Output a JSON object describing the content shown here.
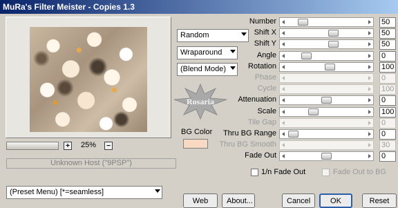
{
  "window": {
    "title": "MuRa's Filter Meister - Copies 1.3"
  },
  "preview": {
    "zoom": "25%",
    "zoom_in_label": "+",
    "zoom_out_label": "−",
    "host_status": "Unknown Host (\"9PSP\")"
  },
  "combos": {
    "mode": "Random",
    "edge": "Wraparound",
    "blend": "(Blend Mode)",
    "preset": "(Preset Menu)  [*=seamless]"
  },
  "logo_text": "Rosaria",
  "bg_color": {
    "label": "BG Color",
    "swatch": "#f8d9c3"
  },
  "params": [
    {
      "label": "Number",
      "value": "50",
      "level": 0.15,
      "enabled": true
    },
    {
      "label": "Shift X",
      "value": "50",
      "level": 0.6,
      "enabled": true
    },
    {
      "label": "Shift Y",
      "value": "50",
      "level": 0.6,
      "enabled": true
    },
    {
      "label": "Angle",
      "value": "0",
      "level": 0.2,
      "enabled": true
    },
    {
      "label": "Rotation",
      "value": "100",
      "level": 0.55,
      "enabled": true
    },
    {
      "label": "Phase",
      "value": "0",
      "level": 0.0,
      "enabled": false
    },
    {
      "label": "Cycle",
      "value": "100",
      "level": 0.0,
      "enabled": false
    },
    {
      "label": "Attenuation",
      "value": "0",
      "level": 0.5,
      "enabled": true
    },
    {
      "label": "Scale",
      "value": "100",
      "level": 0.3,
      "enabled": true
    },
    {
      "label": "Tile Gap",
      "value": "0",
      "level": 0.0,
      "enabled": false
    },
    {
      "label": "Thru BG Range",
      "value": "0",
      "level": 0.0,
      "enabled": true
    },
    {
      "label": "Thru BG Smooth",
      "value": "30",
      "level": 0.0,
      "enabled": false
    },
    {
      "label": "Fade Out",
      "value": "0",
      "level": 0.5,
      "enabled": true
    }
  ],
  "checkboxes": {
    "inverse_fade": "1/n Fade Out",
    "fade_to_bg": "Fade Out to BG"
  },
  "buttons": {
    "web": "Web",
    "about": "About...",
    "cancel": "Cancel",
    "ok": "OK",
    "reset": "Reset"
  }
}
